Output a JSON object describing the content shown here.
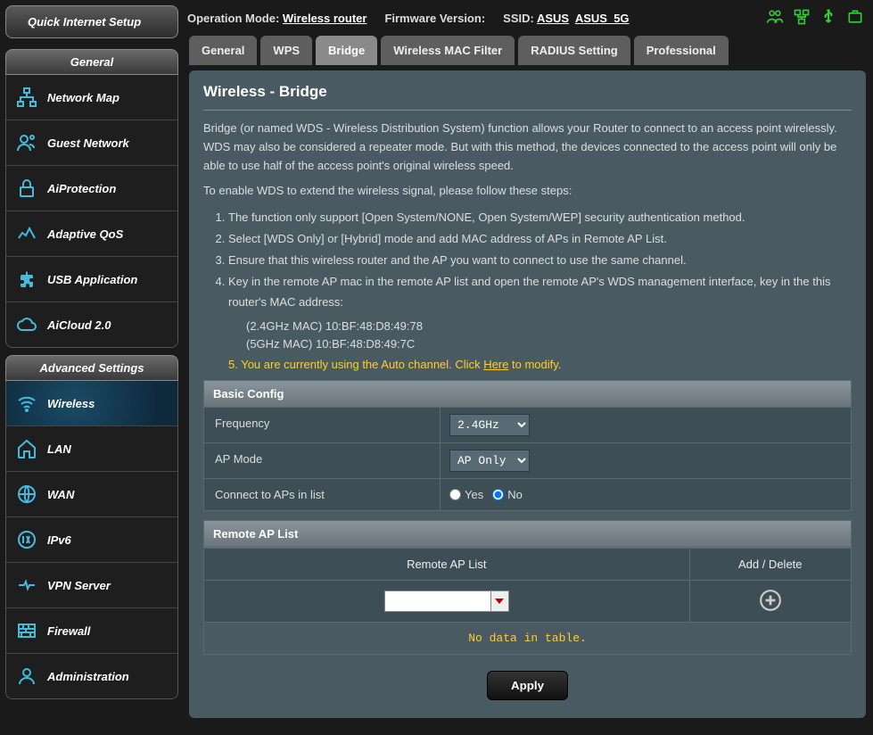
{
  "topbar": {
    "opmode_label": "Operation Mode:",
    "opmode_value": "Wireless router",
    "fw_label": "Firmware Version:",
    "ssid_label": "SSID:",
    "ssid1": "ASUS",
    "ssid2": "ASUS_5G"
  },
  "qis": {
    "label": "Quick Internet Setup"
  },
  "section_general": "General",
  "section_advanced": "Advanced Settings",
  "general_menu": [
    {
      "label": "Network Map"
    },
    {
      "label": "Guest Network"
    },
    {
      "label": "AiProtection"
    },
    {
      "label": "Adaptive QoS"
    },
    {
      "label": "USB Application"
    },
    {
      "label": "AiCloud 2.0"
    }
  ],
  "advanced_menu": [
    {
      "label": "Wireless",
      "active": true
    },
    {
      "label": "LAN"
    },
    {
      "label": "WAN"
    },
    {
      "label": "IPv6"
    },
    {
      "label": "VPN Server"
    },
    {
      "label": "Firewall"
    },
    {
      "label": "Administration"
    }
  ],
  "tabs": [
    {
      "label": "General"
    },
    {
      "label": "WPS"
    },
    {
      "label": "Bridge",
      "active": true
    },
    {
      "label": "Wireless MAC Filter"
    },
    {
      "label": "RADIUS Setting"
    },
    {
      "label": "Professional"
    }
  ],
  "panel": {
    "title": "Wireless - Bridge",
    "desc1": "Bridge (or named WDS - Wireless Distribution System) function allows your Router to connect to an access point wirelessly. WDS may also be considered a repeater mode. But with this method, the devices connected to the access point will only be able to use half of the access point's original wireless speed.",
    "desc2": "To enable WDS to extend the wireless signal, please follow these steps:",
    "steps": [
      "The function only support [Open System/NONE, Open System/WEP] security authentication method.",
      "Select [WDS Only] or [Hybrid] mode and add MAC address of APs in Remote AP List.",
      "Ensure that this wireless router and the AP you want to connect to use the same channel.",
      "Key in the remote AP mac in the remote AP list and open the remote AP's WDS management interface, key in the this router's MAC address:"
    ],
    "mac24_label": "(2.4GHz MAC) ",
    "mac24": "10:BF:48:D8:49:78",
    "mac5_label": "(5GHz MAC) ",
    "mac5": "10:BF:48:D8:49:7C",
    "step5_prefix": "5. You are currently using the Auto channel. Click ",
    "step5_link": "Here",
    "step5_suffix": " to modify."
  },
  "basic_config": {
    "head": "Basic Config",
    "freq_label": "Frequency",
    "freq_value": "2.4GHz",
    "apmode_label": "AP Mode",
    "apmode_value": "AP Only",
    "connect_label": "Connect to APs in list",
    "yes": "Yes",
    "no": "No"
  },
  "remote_ap": {
    "head": "Remote AP List",
    "col_list": "Remote AP List",
    "col_action": "Add / Delete",
    "no_data": "No data in table."
  },
  "apply": "Apply"
}
